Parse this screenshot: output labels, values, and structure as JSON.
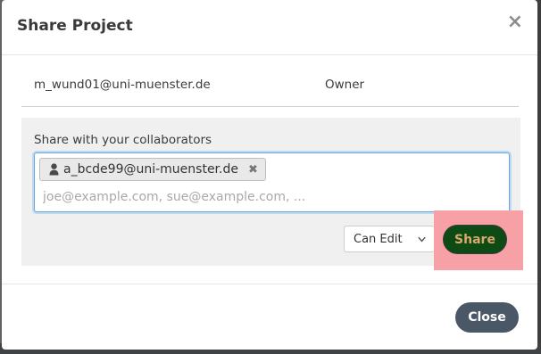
{
  "modal": {
    "title": "Share Project",
    "close_symbol": "×",
    "owner": {
      "email": "m_wund01@uni-muenster.de",
      "role": "Owner"
    },
    "share": {
      "label": "Share with your collaborators",
      "tags": [
        {
          "icon": "user-icon",
          "text": "a_bcde99@uni-muenster.de",
          "remove_symbol": "✖"
        }
      ],
      "input_placeholder": "joe@example.com, sue@example.com, ...",
      "input_value": "",
      "permission_selected": "Can Edit",
      "share_button_label": "Share"
    },
    "footer": {
      "close_button_label": "Close"
    }
  },
  "colors": {
    "share_button_bg": "#0d4a14",
    "share_button_text": "#d9a86b",
    "highlight": "#f7a1a6",
    "close_button_bg": "#4a5767",
    "input_focus_border": "#69a8e0"
  }
}
